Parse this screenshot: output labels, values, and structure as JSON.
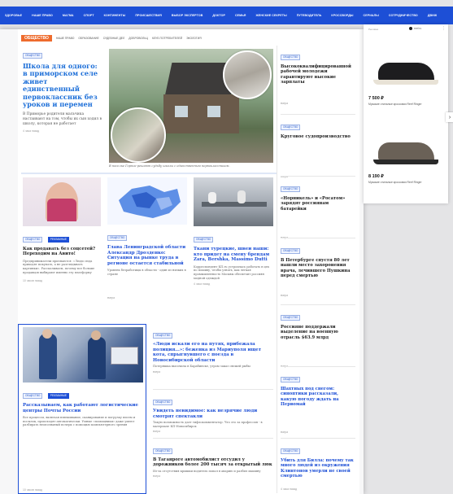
{
  "nav": {
    "items": [
      "ЗДОРОВЬЕ",
      "НАШЕ ПРАВО",
      "МАГМА",
      "СПОРТ",
      "КОНТИНЕНТЫ",
      "ПРОИСШЕСТВИЯ",
      "ВЫБОР ЭКСПЕРТОВ",
      "ДОКТОР",
      "СЕМЬЯ",
      "ЖЕНСКИЕ СЕКРЕТЫ",
      "ПУТЕВОДИТЕЛЬ",
      "КРОССВОРДЫ",
      "СЕРИАЛЫ",
      "СОТРУДНИЧЕСТВО",
      "ДВИЖ"
    ]
  },
  "section": {
    "badge": "ОБЩЕСТВО",
    "links": [
      "НАШЕ ПРАВО",
      "ОБРАЗОВАНИЕ",
      "СУДЕБНЫЕ ДЕЛ",
      "ДОБРОВОЛЬЦ",
      "КЛУБ ПОТРЕБИТЕЛЕЙ",
      "ЭКОЛОГИЯ"
    ]
  },
  "tags": {
    "society": "ОБЩЕСТВО",
    "advertising": "РЕКЛАМНЫЕ"
  },
  "lead_article": {
    "title": "Школа для одного: в приморском селе живет единственный первоклассник без уроков и перемен",
    "lead": "В Приморье родители мальчика настаивают на том, чтобы их сын ходил в школу, которая не работает",
    "time": "4 часа назад",
    "caption": "В поселке Горное решают судьбу школы с единственным первоклассником."
  },
  "side_top": [
    {
      "title": "Высококвалифицированной рабочей молодежи гарантируют высокие зарплаты",
      "time": "вчера"
    },
    {
      "title": "Круговое судопроизводство",
      "time": "вчера"
    }
  ],
  "row2": [
    {
      "title": "Как продавать без соцсетей? Переходим на Авито!",
      "lead": "Предприниматели признаются: «Люди сюда приходят покупать, а не разглядывать картинки». Рассказываем, почему все больше продавцов выбирают именно эту платформу",
      "time": "10 часов назад"
    },
    {
      "title": "Глава Ленинградской области Александр Дрозденко: Ситуация на рынке труда в регионе остается стабильной",
      "lead": "Уровень безработицы в области - один из низких в стране",
      "time": "вчера"
    },
    {
      "title": "Ткани турецкие, швеи наши: кто придет на смену брендам Zara, Bershka, Massimo Dutti",
      "lead": "Корреспондент КП.ru устроилась работать в цех по пошиву, чтобы узнать, как легкая промышленность Москвы обеспечит россиян модной одеждой",
      "time": "4 часа назад"
    }
  ],
  "side_mid": [
    {
      "title": "«Норникель» и «Росатом» зарядят россиянам батарейки",
      "time": "вчера"
    },
    {
      "title": "В Петербурге спустя 80 лет нашли место захоронения врача, лечившего Пушкина перед смертью",
      "time": "вчера"
    },
    {
      "title": "Россияне поддержали выделение на военную отрасль $63.9 млрд",
      "time": "вчера"
    }
  ],
  "post_article": {
    "title": "Рассказываем, как работают логистические центры Почты России",
    "lead": "Все процессы, включая взвешивание, сканирование и погрузку писем и посылок, происходят автоматически. Умные «помощники» даже умеют разбирать неопознаный почерк с помощью компьютерного зрения",
    "time": "10 часов назад"
  },
  "center_list": [
    {
      "title": "«Люди искали его на путях, прибежала полиция...»: беженка из Мариуполя ищет кота, спрыгнувшего с поезда в Новосибирской области",
      "lead": "Потеряшка высочила в Барабинске, утром заказ свежей рыбы",
      "time": "вчера"
    },
    {
      "title": "Увидеть невидимое: как незрячие люди смотрят спектакли",
      "lead": "Такую возможность дает тифлокомментатор. Что это за профессия - в материале КП-Новосибирск",
      "time": "вчера"
    },
    {
      "title": "В Таганроге автомобилист отсудил у дорожников более 200 тысяч за открытый люк",
      "lead": "Из-за отсутствия крышки водитель попал в аварию и разбил машину",
      "time": "вчера"
    }
  ],
  "side_bottom": [
    {
      "title": "Шахтных под снегом: синоптики рассказали, какую погоду ждать на Первомай",
      "time": "вчера"
    },
    {
      "title": "Убить для Билла: почему так много людей из окружения Клинтонов умерли не своей смертью",
      "time": "4 часа назад"
    }
  ],
  "ad": {
    "label": "Реклама",
    "brand": "reef.ru",
    "items": [
      {
        "price": "7 500 ₽",
        "desc": "Мужские стильные кроссовки Reef Ringer"
      },
      {
        "price": "8 190 ₽",
        "desc": "Мужские стильные кроссовки Reef Ringer"
      }
    ]
  },
  "colors": {
    "nav": "#1d4fd6",
    "badge": "#ee6b2d",
    "headline": "#1d6fd8"
  }
}
